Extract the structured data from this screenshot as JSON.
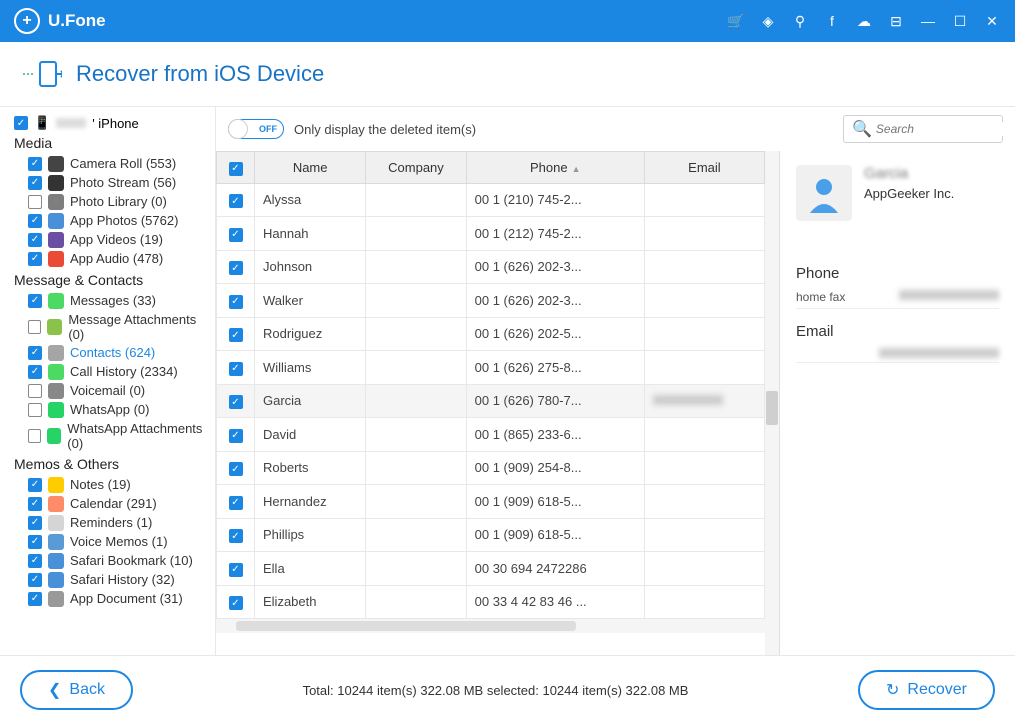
{
  "app_name": "U.Fone",
  "header_title": "Recover from iOS Device",
  "device_name": "' iPhone",
  "categories": [
    {
      "label": "Media",
      "items": [
        {
          "label": "Camera Roll (553)",
          "checked": true,
          "color": "#444"
        },
        {
          "label": "Photo Stream (56)",
          "checked": true,
          "color": "#333"
        },
        {
          "label": "Photo Library (0)",
          "checked": false,
          "color": "#7e7e7e"
        },
        {
          "label": "App Photos (5762)",
          "checked": true,
          "color": "#4a90d9"
        },
        {
          "label": "App Videos (19)",
          "checked": true,
          "color": "#6b4fa3"
        },
        {
          "label": "App Audio (478)",
          "checked": true,
          "color": "#e94b35"
        }
      ]
    },
    {
      "label": "Message & Contacts",
      "items": [
        {
          "label": "Messages (33)",
          "checked": true,
          "color": "#4cd964"
        },
        {
          "label": "Message Attachments (0)",
          "checked": false,
          "color": "#8bc34a"
        },
        {
          "label": "Contacts (624)",
          "checked": true,
          "color": "#a5a5a5",
          "active": true
        },
        {
          "label": "Call History (2334)",
          "checked": true,
          "color": "#4cd964"
        },
        {
          "label": "Voicemail (0)",
          "checked": false,
          "color": "#888"
        },
        {
          "label": "WhatsApp (0)",
          "checked": false,
          "color": "#25d366"
        },
        {
          "label": "WhatsApp Attachments (0)",
          "checked": false,
          "color": "#25d366"
        }
      ]
    },
    {
      "label": "Memos & Others",
      "items": [
        {
          "label": "Notes (19)",
          "checked": true,
          "color": "#ffcc00"
        },
        {
          "label": "Calendar (291)",
          "checked": true,
          "color": "#ff8c69"
        },
        {
          "label": "Reminders (1)",
          "checked": true,
          "color": "#d5d5d5"
        },
        {
          "label": "Voice Memos (1)",
          "checked": true,
          "color": "#5a9bd5"
        },
        {
          "label": "Safari Bookmark (10)",
          "checked": true,
          "color": "#4a90d9"
        },
        {
          "label": "Safari History (32)",
          "checked": true,
          "color": "#4a90d9"
        },
        {
          "label": "App Document (31)",
          "checked": true,
          "color": "#999"
        }
      ]
    }
  ],
  "toggle": {
    "state": "OFF",
    "label": "Only display the deleted item(s)"
  },
  "search": {
    "placeholder": "Search"
  },
  "columns": [
    "Name",
    "Company",
    "Phone",
    "Email"
  ],
  "rows": [
    {
      "name": "Alyssa",
      "company": "",
      "phone": "00 1 (210) 745-2...",
      "email": ""
    },
    {
      "name": "Hannah",
      "company": "",
      "phone": "00 1 (212) 745-2...",
      "email": ""
    },
    {
      "name": "Johnson",
      "company": "",
      "phone": "00 1 (626) 202-3...",
      "email": ""
    },
    {
      "name": "Walker",
      "company": "",
      "phone": "00 1 (626) 202-3...",
      "email": ""
    },
    {
      "name": "Rodriguez",
      "company": "",
      "phone": "00 1 (626) 202-5...",
      "email": ""
    },
    {
      "name": "Williams",
      "company": "",
      "phone": "00 1 (626) 275-8...",
      "email": ""
    },
    {
      "name": "Garcia",
      "company": "",
      "phone": "00 1 (626) 780-7...",
      "email": "",
      "selected": true,
      "hasEmail": true
    },
    {
      "name": "David",
      "company": "",
      "phone": "00 1 (865) 233-6...",
      "email": ""
    },
    {
      "name": "Roberts",
      "company": "",
      "phone": "00 1 (909) 254-8...",
      "email": ""
    },
    {
      "name": "Hernandez",
      "company": "",
      "phone": "00 1 (909) 618-5...",
      "email": ""
    },
    {
      "name": "Phillips",
      "company": "",
      "phone": "00 1 (909) 618-5...",
      "email": ""
    },
    {
      "name": "Ella",
      "company": "",
      "phone": "00 30 694 2472286",
      "email": ""
    },
    {
      "name": "Elizabeth",
      "company": "",
      "phone": "00 33 4 42 83 46 ...",
      "email": ""
    }
  ],
  "detail": {
    "name": "Garcia",
    "company": "AppGeeker Inc.",
    "phone_label": "Phone",
    "phone_type": "home fax",
    "email_label": "Email"
  },
  "footer": {
    "back": "Back",
    "recover": "Recover",
    "status": "Total: 10244 item(s) 322.08 MB    selected: 10244 item(s) 322.08 MB"
  }
}
